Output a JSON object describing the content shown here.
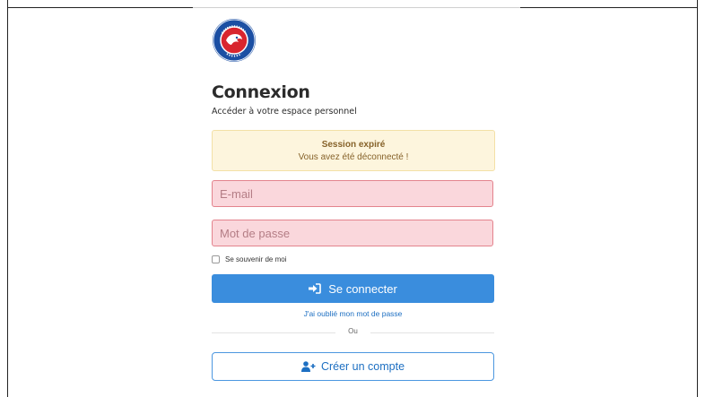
{
  "logo": {
    "text_top": "C.S. BETTON",
    "text_bottom": "1967",
    "icon": "club-crest"
  },
  "header": {
    "title": "Connexion",
    "subtitle": "Accéder à votre espace personnel"
  },
  "alert": {
    "title": "Session expiré",
    "message": "Vous avez été déconnecté !"
  },
  "form": {
    "email_placeholder": "E-mail",
    "password_placeholder": "Mot de passe",
    "remember_label": "Se souvenir de moi",
    "remember_checked": false,
    "submit_label": "Se connecter",
    "submit_icon": "sign-in-icon",
    "forgot_label": "J'ai oublié mon mot de passe"
  },
  "divider": {
    "text": "Ou"
  },
  "register": {
    "label": "Créer un compte",
    "icon": "user-plus-icon"
  },
  "colors": {
    "primary": "#3a8ddd",
    "link": "#1d6fc2",
    "error_bg": "#fad7dc",
    "error_border": "#e3838d",
    "alert_bg": "#fdf5dd"
  }
}
